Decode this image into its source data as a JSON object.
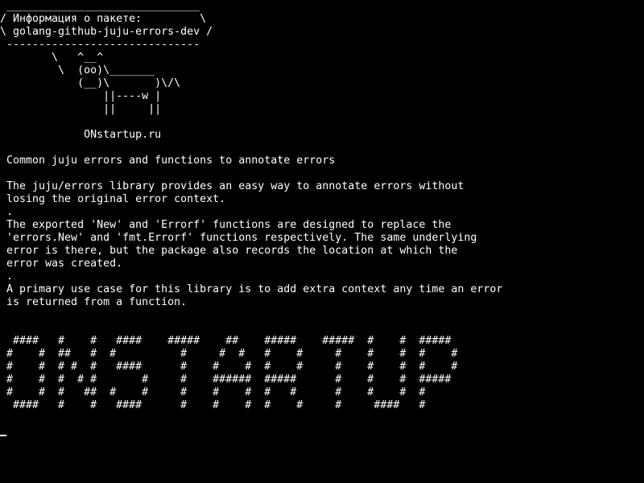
{
  "terminal": {
    "background": "#000000",
    "foreground": "#ffffff",
    "lines": [
      " ______________________________",
      "/ Информация о пакете:         \\",
      "\\ golang-github-juju-errors-dev /",
      " ------------------------------",
      "        \\   ^__^",
      "         \\  (oo)\\_______",
      "            (__)\\       )\\/\\",
      "                ||----w |",
      "                ||     ||",
      "",
      "             ONstartup.ru",
      "",
      " Common juju errors and functions to annotate errors",
      "",
      " The juju/errors library provides an easy way to annotate errors without",
      " losing the original error context.",
      " .",
      " The exported 'New' and 'Errorf' functions are designed to replace the",
      " 'errors.New' and 'fmt.Errorf' functions respectively. The same underlying",
      " error is there, but the package also records the location at which the",
      " error was created.",
      " .",
      " A primary use case for this library is to add extra context any time an error",
      " is returned from a function.",
      "",
      "",
      "  ####   #    #   ####    #####    ##    #####    #####  #    #  #####",
      " #    #  ##   #  #          #     #  #   #    #     #    #    #  #    #",
      " #    #  # #  #   ####      #    #    #  #    #     #    #    #  #    #",
      " #    #  #  # #       #     #    ######  #####      #    #    #  #####",
      " #    #  #   ##  #    #     #    #    #  #   #      #    #    #  #",
      "  ####   #    #   ####      #    #    #  #    #     #     ####   #"
    ]
  }
}
